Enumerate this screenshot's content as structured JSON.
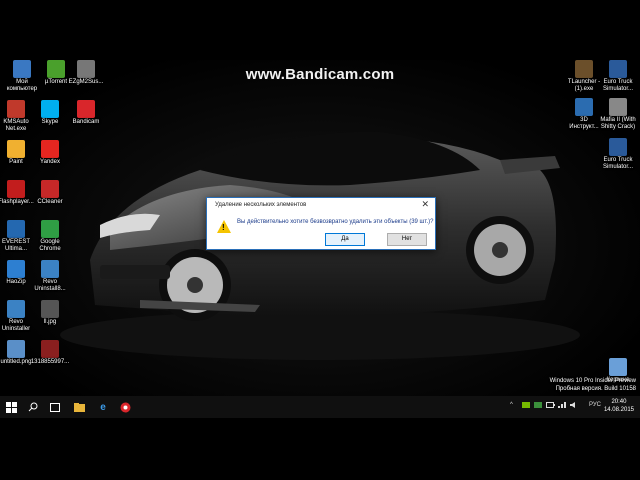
{
  "watermark": "www.Bandicam.com",
  "desktop_icons_left": [
    {
      "label": "Мой\nкомпьютер",
      "icon": "computer-icon",
      "color": "#3a78c2"
    },
    {
      "label": "µTorrent",
      "icon": "utorrent-icon",
      "color": "#4aa02c"
    },
    {
      "label": "EZgM2Sus...",
      "icon": "file-icon",
      "color": "#777777"
    },
    {
      "label": "KMSAuto\nNet.exe",
      "icon": "kmsauto-icon",
      "color": "#c0392b"
    },
    {
      "label": "Skype",
      "icon": "skype-icon",
      "color": "#00aff0"
    },
    {
      "label": "Bandicam",
      "icon": "bandicam-icon",
      "color": "#d9262b"
    },
    {
      "label": "Paint",
      "icon": "paint-icon",
      "color": "#f0b030"
    },
    {
      "label": "Yandex",
      "icon": "yandex-icon",
      "color": "#e52620"
    },
    {
      "label": "Flashplayer...",
      "icon": "flash-icon",
      "color": "#c21d1d"
    },
    {
      "label": "CCleaner",
      "icon": "ccleaner-icon",
      "color": "#c62828"
    },
    {
      "label": "EVEREST\nUltima...",
      "icon": "everest-icon",
      "color": "#2468b0"
    },
    {
      "label": "Google\nChrome",
      "icon": "chrome-icon",
      "color": "#2f9e44"
    },
    {
      "label": "HaoZip",
      "icon": "haozip-icon",
      "color": "#2d7fd1"
    },
    {
      "label": "Revo\nUninstall8...",
      "icon": "revo-icon",
      "color": "#3b82c4"
    },
    {
      "label": "Revo\nUninstaller",
      "icon": "revo-icon",
      "color": "#3b82c4"
    },
    {
      "label": "ll.jpg",
      "icon": "image-icon",
      "color": "#555555"
    },
    {
      "label": "untitled.png",
      "icon": "image-icon",
      "color": "#5a8fc8"
    },
    {
      "label": "1318855997...",
      "icon": "image-icon",
      "color": "#8a1f1f"
    }
  ],
  "desktop_icons_right": [
    {
      "label": "TLauncher -\n(1).exe",
      "icon": "tlauncher-icon",
      "color": "#6b4f2a"
    },
    {
      "label": "Euro Truck\nSimulator...",
      "icon": "eurotruck-icon",
      "color": "#2a5a9a"
    },
    {
      "label": "3D\nИнструкт...",
      "icon": "document-icon",
      "color": "#2b6cb0"
    },
    {
      "label": "Mafia II (With\nShitty Crack)",
      "icon": "file-icon",
      "color": "#888888"
    },
    {
      "label": "Euro Truck\nSimulator...",
      "icon": "eurotruck-icon",
      "color": "#2a5a9a"
    },
    {
      "label": "Корзина",
      "icon": "recycle-bin-icon",
      "color": "#6a9fd8"
    }
  ],
  "dialog": {
    "title": "Удаление нескольких элементов",
    "message": "Вы действительно хотите безвозвратно удалить эти объекты (39 шт.)?",
    "yes_label": "Да",
    "no_label": "Нет",
    "close": "✕"
  },
  "windows_info": {
    "line1": "Windows 10 Pro Insider Preview",
    "line2": "Пробная версия. Build 10158"
  },
  "taskbar": {
    "lang": "РУС",
    "time": "20:40",
    "date": "14.08.2015"
  }
}
